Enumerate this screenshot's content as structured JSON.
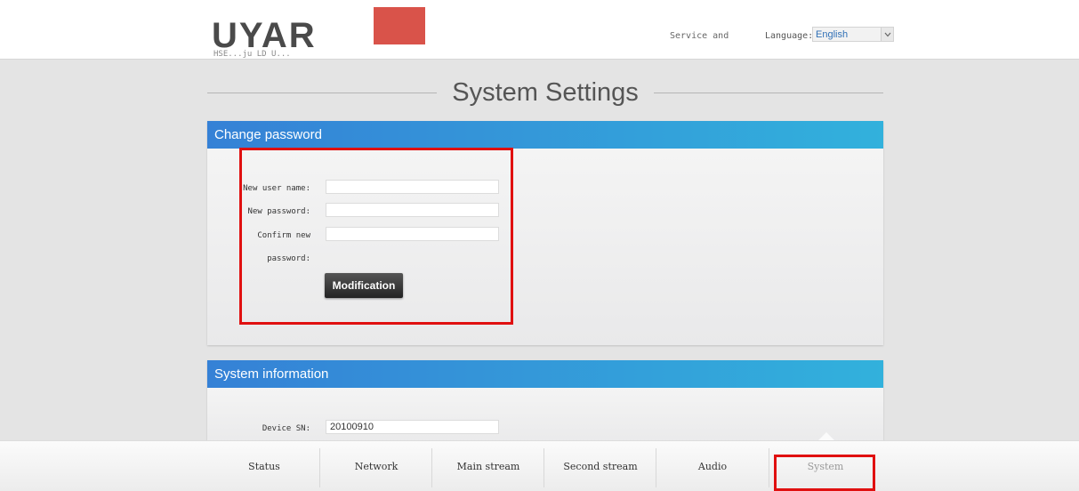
{
  "header": {
    "logo_text": "UYAR",
    "logo_subtext": "HSE...ju LD U...",
    "service_link": "Service and",
    "language_label": "Language:",
    "language_value": "English"
  },
  "page_title": "System Settings",
  "change_password": {
    "heading": "Change password",
    "new_user_label": "New user name:",
    "new_user_value": "",
    "new_password_label": "New password:",
    "new_password_value": "",
    "confirm_label_line1": "Confirm new",
    "confirm_label_line2": "password:",
    "confirm_value": "",
    "submit_label": "Modification"
  },
  "system_info": {
    "heading": "System information",
    "device_sn_label": "Device SN:",
    "device_sn_value": "20100910"
  },
  "bottom_nav": {
    "items": [
      "Status",
      "Network",
      "Main stream",
      "Second stream",
      "Audio",
      "System"
    ],
    "active": "System"
  },
  "colors": {
    "panel_head_start": "#3581d6",
    "panel_head_end": "#32b1dc",
    "highlight": "#e01010",
    "logo_red": "#d9534a"
  }
}
